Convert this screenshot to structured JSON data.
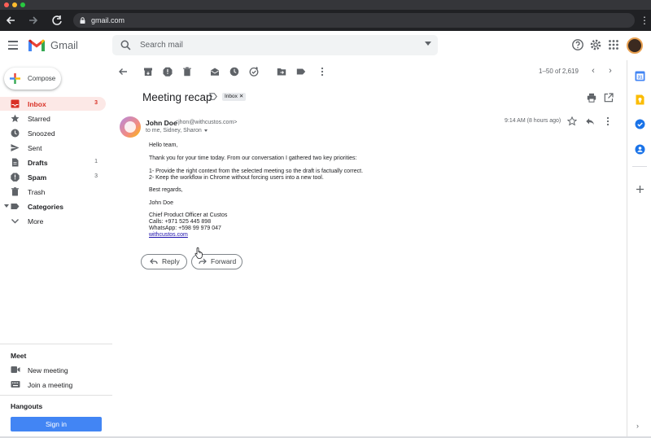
{
  "browser": {
    "url": "gmail.com"
  },
  "header": {
    "app_name": "Gmail",
    "search_placeholder": "Search mail"
  },
  "sidebar": {
    "compose_label": "Compose",
    "items": [
      {
        "label": "Inbox",
        "count": "3",
        "icon": "inbox-icon",
        "active": true
      },
      {
        "label": "Starred",
        "count": "",
        "icon": "star-icon"
      },
      {
        "label": "Snoozed",
        "count": "",
        "icon": "clock-icon"
      },
      {
        "label": "Sent",
        "count": "",
        "icon": "send-icon"
      },
      {
        "label": "Drafts",
        "count": "1",
        "icon": "draft-icon"
      },
      {
        "label": "Spam",
        "count": "3",
        "icon": "spam-icon"
      },
      {
        "label": "Trash",
        "count": "",
        "icon": "trash-icon"
      },
      {
        "label": "Categories",
        "count": "",
        "icon": "label-icon"
      },
      {
        "label": "More",
        "count": "",
        "icon": "chevron-down-icon"
      }
    ],
    "meet": {
      "title": "Meet",
      "new_meeting": "New meeting",
      "join_meeting": "Join a meeting"
    },
    "hangouts": {
      "title": "Hangouts",
      "sign_in": "Sign in"
    }
  },
  "toolbar": {
    "page_count": "1–50 of 2,619"
  },
  "email": {
    "subject": "Meeting recap",
    "label_chip": "Inbox",
    "sender_name": "John Doe",
    "sender_email": "<jhon@withcustos.com>",
    "recipients": "to me, Sidney, Sharon",
    "timestamp": "9:14 AM (8 hours ago)",
    "body": {
      "greeting": "Hello team,",
      "intro": "Thank you for your time today. From our conversation I gathered two key priorities:",
      "point1": "1- Provide the right context from the selected meeting so the draft is factually correct.",
      "point2": "2- Keep the workflow in Chrome without forcing users into a new tool.",
      "closing": "Best regards,",
      "name": "John Doe",
      "title": "Chief Product Officer at Custos",
      "calls": "Calls: +971 525 445 898",
      "whatsapp": "WhatsApp: +598 99 979 047",
      "website": "withcustos.com"
    },
    "reply_label": "Reply",
    "forward_label": "Forward"
  },
  "colors": {
    "accent_red": "#d93025",
    "inbox_active_bg": "#fce8e6",
    "sign_in_blue": "#4285f4"
  }
}
